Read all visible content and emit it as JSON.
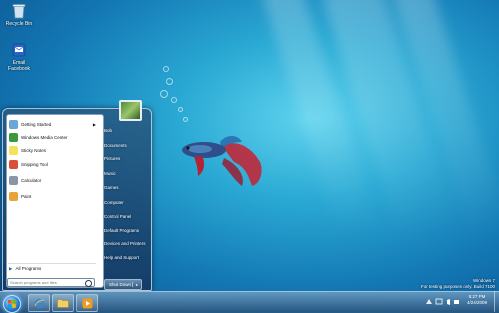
{
  "desktop_icons": [
    {
      "label": "Recycle Bin",
      "icon": "recycle-bin-icon"
    },
    {
      "label": "Email Facebook",
      "icon": "email-icon"
    }
  ],
  "start_menu": {
    "programs": [
      {
        "label": "Getting Started",
        "icon": "getting-started-icon",
        "has_submenu": true,
        "color": "#6aa7d8"
      },
      {
        "label": "Windows Media Center",
        "icon": "media-center-icon",
        "has_submenu": false,
        "color": "#3a9a3a"
      },
      {
        "label": "Sticky Notes",
        "icon": "sticky-notes-icon",
        "has_submenu": false,
        "color": "#f3e35a"
      },
      {
        "label": "Snipping Tool",
        "icon": "snipping-tool-icon",
        "has_submenu": false,
        "color": "#d8503a"
      },
      {
        "label": "Calculator",
        "icon": "calculator-icon",
        "has_submenu": false,
        "color": "#8a96a6"
      },
      {
        "label": "Paint",
        "icon": "paint-icon",
        "has_submenu": false,
        "color": "#e9a23a"
      }
    ],
    "all_programs_label": "All Programs",
    "search_placeholder": "Search programs and files",
    "right_items": [
      "Bob",
      "Documents",
      "Pictures",
      "Music",
      "Games",
      "Computer",
      "Control Panel",
      "Default Programs",
      "Devices and Printers",
      "Help and Support"
    ],
    "shutdown_label": "Shut Down"
  },
  "taskbar": {
    "pinned": [
      {
        "name": "internet-explorer",
        "icon": "internet-explorer-icon"
      },
      {
        "name": "windows-explorer",
        "icon": "folder-icon"
      },
      {
        "name": "media-player",
        "icon": "media-player-icon"
      }
    ],
    "clock_time": "5:27 PM",
    "clock_date": "4/24/2009"
  },
  "watermark": {
    "line1": "Windows 7",
    "line2": "For testing purposes only. Build 7100"
  }
}
